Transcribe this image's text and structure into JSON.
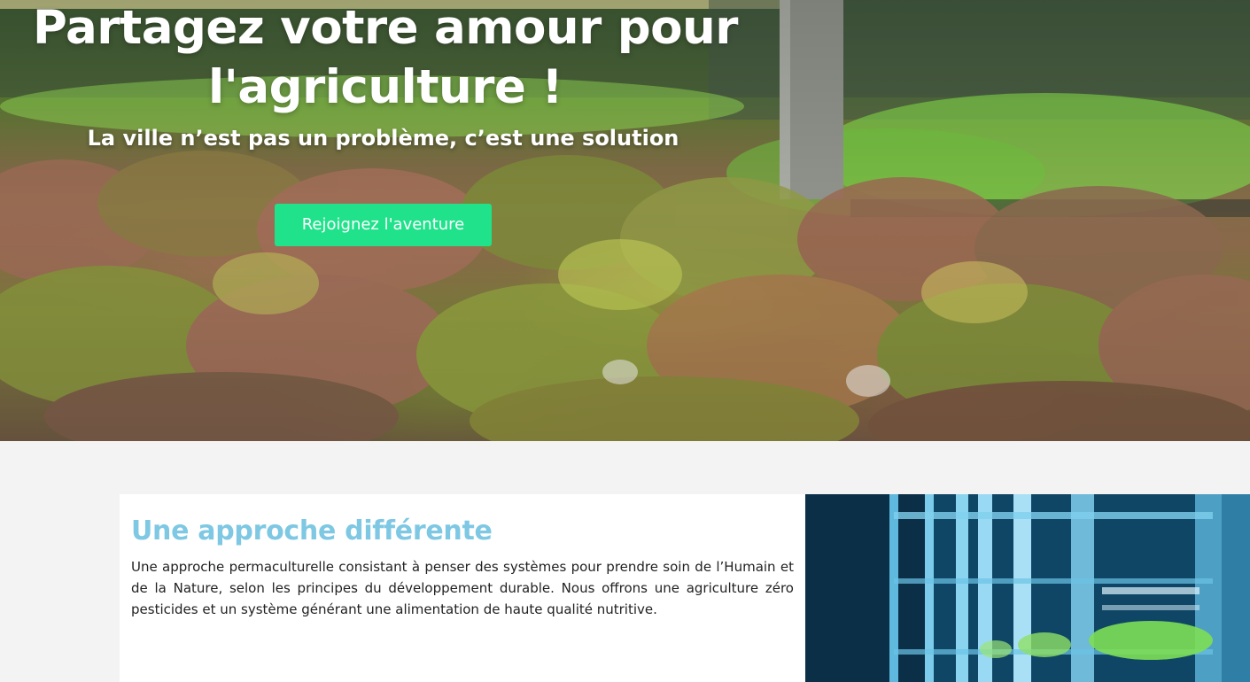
{
  "hero": {
    "title_line1": "Partagez votre amour pour",
    "title_line2": "l'agriculture !",
    "subtitle": "La ville n’est pas un problème, c’est une solution",
    "cta_label": "Rejoignez l'aventure",
    "image": "lettuce-field-photo"
  },
  "feature": {
    "title": "Une approche différente",
    "text": "Une approche permaculturelle consistant à penser des systèmes pour prendre soin de l’Humain et de la Nature, selon les principes du développement durable. Nous offrons une agriculture zéro pesticides et un système générant une alimentation de haute qualité nutritive.",
    "image": "vertical-farm-shelves-photo"
  },
  "colors": {
    "page_background": "#f3f3f3",
    "cta_background": "#1fe28a",
    "feature_title": "#7ec8e3",
    "body_text": "#222222"
  }
}
